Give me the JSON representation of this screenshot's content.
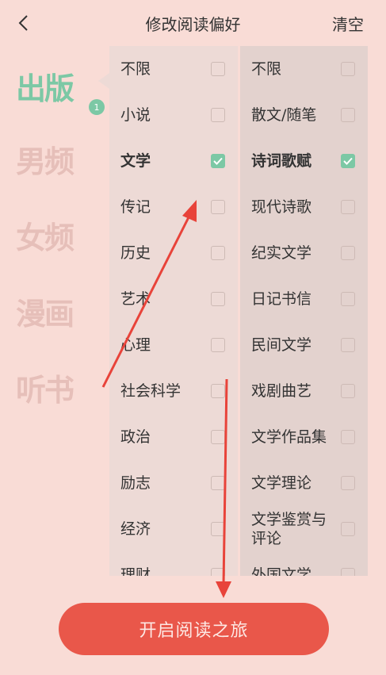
{
  "header": {
    "title": "修改阅读偏好",
    "clear_label": "清空"
  },
  "sidebar": {
    "items": [
      {
        "label": "出版",
        "active": true,
        "badge": "1"
      },
      {
        "label": "男频",
        "active": false
      },
      {
        "label": "女频",
        "active": false
      },
      {
        "label": "漫画",
        "active": false
      },
      {
        "label": "听书",
        "active": false
      }
    ]
  },
  "left_column": [
    {
      "label": "不限",
      "checked": false
    },
    {
      "label": "小说",
      "checked": false
    },
    {
      "label": "文学",
      "checked": true
    },
    {
      "label": "传记",
      "checked": false
    },
    {
      "label": "历史",
      "checked": false
    },
    {
      "label": "艺术",
      "checked": false
    },
    {
      "label": "心理",
      "checked": false
    },
    {
      "label": "社会科学",
      "checked": false
    },
    {
      "label": "政治",
      "checked": false
    },
    {
      "label": "励志",
      "checked": false
    },
    {
      "label": "经济",
      "checked": false
    },
    {
      "label": "理财",
      "checked": false
    }
  ],
  "right_column": [
    {
      "label": "不限",
      "checked": false
    },
    {
      "label": "散文/随笔",
      "checked": false
    },
    {
      "label": "诗词歌赋",
      "checked": true
    },
    {
      "label": "现代诗歌",
      "checked": false
    },
    {
      "label": "纪实文学",
      "checked": false
    },
    {
      "label": "日记书信",
      "checked": false
    },
    {
      "label": "民间文学",
      "checked": false
    },
    {
      "label": "戏剧曲艺",
      "checked": false
    },
    {
      "label": "文学作品集",
      "checked": false
    },
    {
      "label": "文学理论",
      "checked": false
    },
    {
      "label": "文学鉴赏与评论",
      "checked": false
    },
    {
      "label": "外国文学",
      "checked": false
    }
  ],
  "footer": {
    "start_label": "开启阅读之旅"
  },
  "colors": {
    "accent": "#7cc8a5",
    "button": "#e9574a",
    "background": "#f9dcd6",
    "annotation": "#e8433a"
  }
}
